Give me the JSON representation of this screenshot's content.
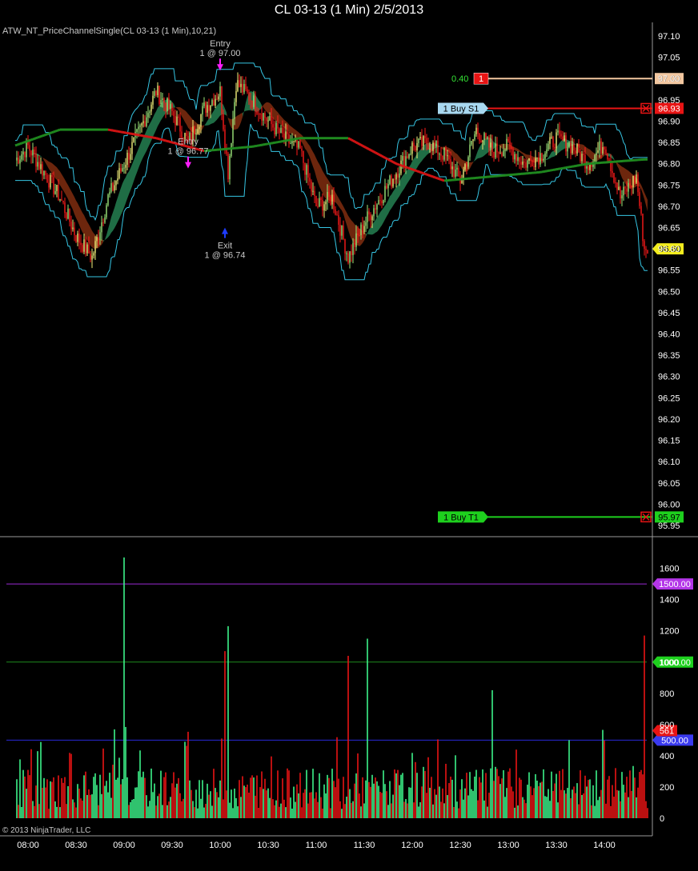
{
  "title": "CL 03-13 (1 Min)  2/5/2013",
  "indicator_label": "ATW_NT_PriceChannelSingle(CL 03-13 (1 Min),10,21)",
  "copyright": "© 2013 NinjaTrader, LLC",
  "colors": {
    "background": "#000000",
    "up_bar": "#f3f07a",
    "up_bar_alt": "#9ee87a",
    "down_bar": "#ff1a1a",
    "channel_line": "#36c6e4",
    "slow_ma_up": "#1f8a1f",
    "slow_ma_down": "#d41414",
    "volume_up": "#3cf28a",
    "volume_down": "#e81414",
    "line_1500": "#9a2ad4",
    "line_1000": "#1e8a1e",
    "line_500": "#2a2ad8",
    "stop_line": "#e81414",
    "target_line": "#1ed01e",
    "order_line": "#f2c7a0"
  },
  "chart_data": [
    {
      "type": "candlestick",
      "panel": "price",
      "ylim": [
        95.95,
        97.1
      ],
      "y_ticks": [
        "97.10",
        "97.05",
        "97.00",
        "96.95",
        "96.90",
        "96.85",
        "96.80",
        "96.75",
        "96.70",
        "96.65",
        "96.60",
        "96.55",
        "96.50",
        "96.45",
        "96.40",
        "96.35",
        "96.30",
        "96.25",
        "96.20",
        "96.15",
        "96.10",
        "96.05",
        "96.00",
        "95.95"
      ],
      "x_ticks": [
        "08:00",
        "08:30",
        "09:00",
        "09:30",
        "10:00",
        "10:30",
        "11:00",
        "11:30",
        "12:00",
        "12:30",
        "13:00",
        "13:30",
        "14:00"
      ],
      "approx_close_path": [
        [
          "07:50",
          96.8
        ],
        [
          "08:00",
          96.84
        ],
        [
          "08:10",
          96.78
        ],
        [
          "08:20",
          96.72
        ],
        [
          "08:30",
          96.63
        ],
        [
          "08:40",
          96.58
        ],
        [
          "08:50",
          96.72
        ],
        [
          "09:00",
          96.8
        ],
        [
          "09:10",
          96.88
        ],
        [
          "09:20",
          96.97
        ],
        [
          "09:30",
          96.92
        ],
        [
          "09:40",
          96.85
        ],
        [
          "09:50",
          96.93
        ],
        [
          "10:00",
          96.97
        ],
        [
          "10:05",
          96.78
        ],
        [
          "10:10",
          96.99
        ],
        [
          "10:20",
          96.95
        ],
        [
          "10:30",
          96.9
        ],
        [
          "10:40",
          96.86
        ],
        [
          "10:50",
          96.83
        ],
        [
          "11:00",
          96.7
        ],
        [
          "11:10",
          96.72
        ],
        [
          "11:20",
          96.58
        ],
        [
          "11:30",
          96.66
        ],
        [
          "11:40",
          96.72
        ],
        [
          "11:50",
          96.78
        ],
        [
          "12:00",
          96.84
        ],
        [
          "12:10",
          96.85
        ],
        [
          "12:20",
          96.82
        ],
        [
          "12:30",
          96.76
        ],
        [
          "12:40",
          96.88
        ],
        [
          "12:50",
          96.83
        ],
        [
          "13:00",
          96.84
        ],
        [
          "13:10",
          96.8
        ],
        [
          "13:20",
          96.82
        ],
        [
          "13:30",
          96.86
        ],
        [
          "13:40",
          96.84
        ],
        [
          "13:50",
          96.8
        ],
        [
          "14:00",
          96.85
        ],
        [
          "14:10",
          96.72
        ],
        [
          "14:20",
          96.77
        ],
        [
          "14:25",
          96.6
        ]
      ],
      "last_price": "96.60",
      "slow_ma": [
        [
          "07:50",
          96.84
        ],
        [
          "08:20",
          96.88
        ],
        [
          "08:50",
          96.88
        ],
        [
          "09:20",
          96.86
        ],
        [
          "09:50",
          96.83
        ],
        [
          "10:20",
          96.84
        ],
        [
          "10:50",
          96.86
        ],
        [
          "11:20",
          96.86
        ],
        [
          "11:50",
          96.8
        ],
        [
          "12:20",
          96.76
        ],
        [
          "12:50",
          96.77
        ],
        [
          "13:20",
          96.78
        ],
        [
          "13:50",
          96.8
        ],
        [
          "14:25",
          96.81
        ]
      ],
      "annotations": [
        {
          "label": "Entry",
          "sublabel": "1 @ 97.00",
          "time": "10:00",
          "price": 97.0,
          "arrow": "down"
        },
        {
          "label": "Entry",
          "sublabel": "1 @ 96.77",
          "time": "09:40",
          "price": 96.77,
          "arrow": "down"
        },
        {
          "label": "Exit",
          "sublabel": "1 @ 96.74",
          "time": "10:03",
          "price": 96.74,
          "arrow": "up"
        }
      ],
      "order_lines": [
        {
          "price": 97.0,
          "left_text": "0.40",
          "tag": "1",
          "price_label": "97.00"
        },
        {
          "price": 96.93,
          "tag": "1  Buy S1",
          "price_label": "96.93"
        },
        {
          "price": 95.97,
          "tag": "1  Buy T1",
          "price_label": "95.97"
        }
      ]
    },
    {
      "type": "bar",
      "panel": "volume",
      "ylim": [
        0,
        1700
      ],
      "y_ticks": [
        "1600",
        "1400",
        "1200",
        "1000",
        "800",
        "600",
        "400",
        "200",
        "0"
      ],
      "reference_lines": [
        {
          "value": 1500,
          "label": "1500.00"
        },
        {
          "value": 1000,
          "label": "1000.00"
        },
        {
          "value": 500,
          "label": "500.00"
        }
      ],
      "last_volume": "561",
      "notable_spikes": [
        {
          "time": "09:00",
          "value": 1670,
          "dir": "up"
        },
        {
          "time": "10:05",
          "value": 1230,
          "dir": "up"
        },
        {
          "time": "10:03",
          "value": 1070,
          "dir": "down"
        },
        {
          "time": "11:20",
          "value": 1040,
          "dir": "down"
        },
        {
          "time": "11:32",
          "value": 1150,
          "dir": "up"
        },
        {
          "time": "12:50",
          "value": 820,
          "dir": "up"
        },
        {
          "time": "14:25",
          "value": 1170,
          "dir": "down"
        }
      ]
    }
  ]
}
